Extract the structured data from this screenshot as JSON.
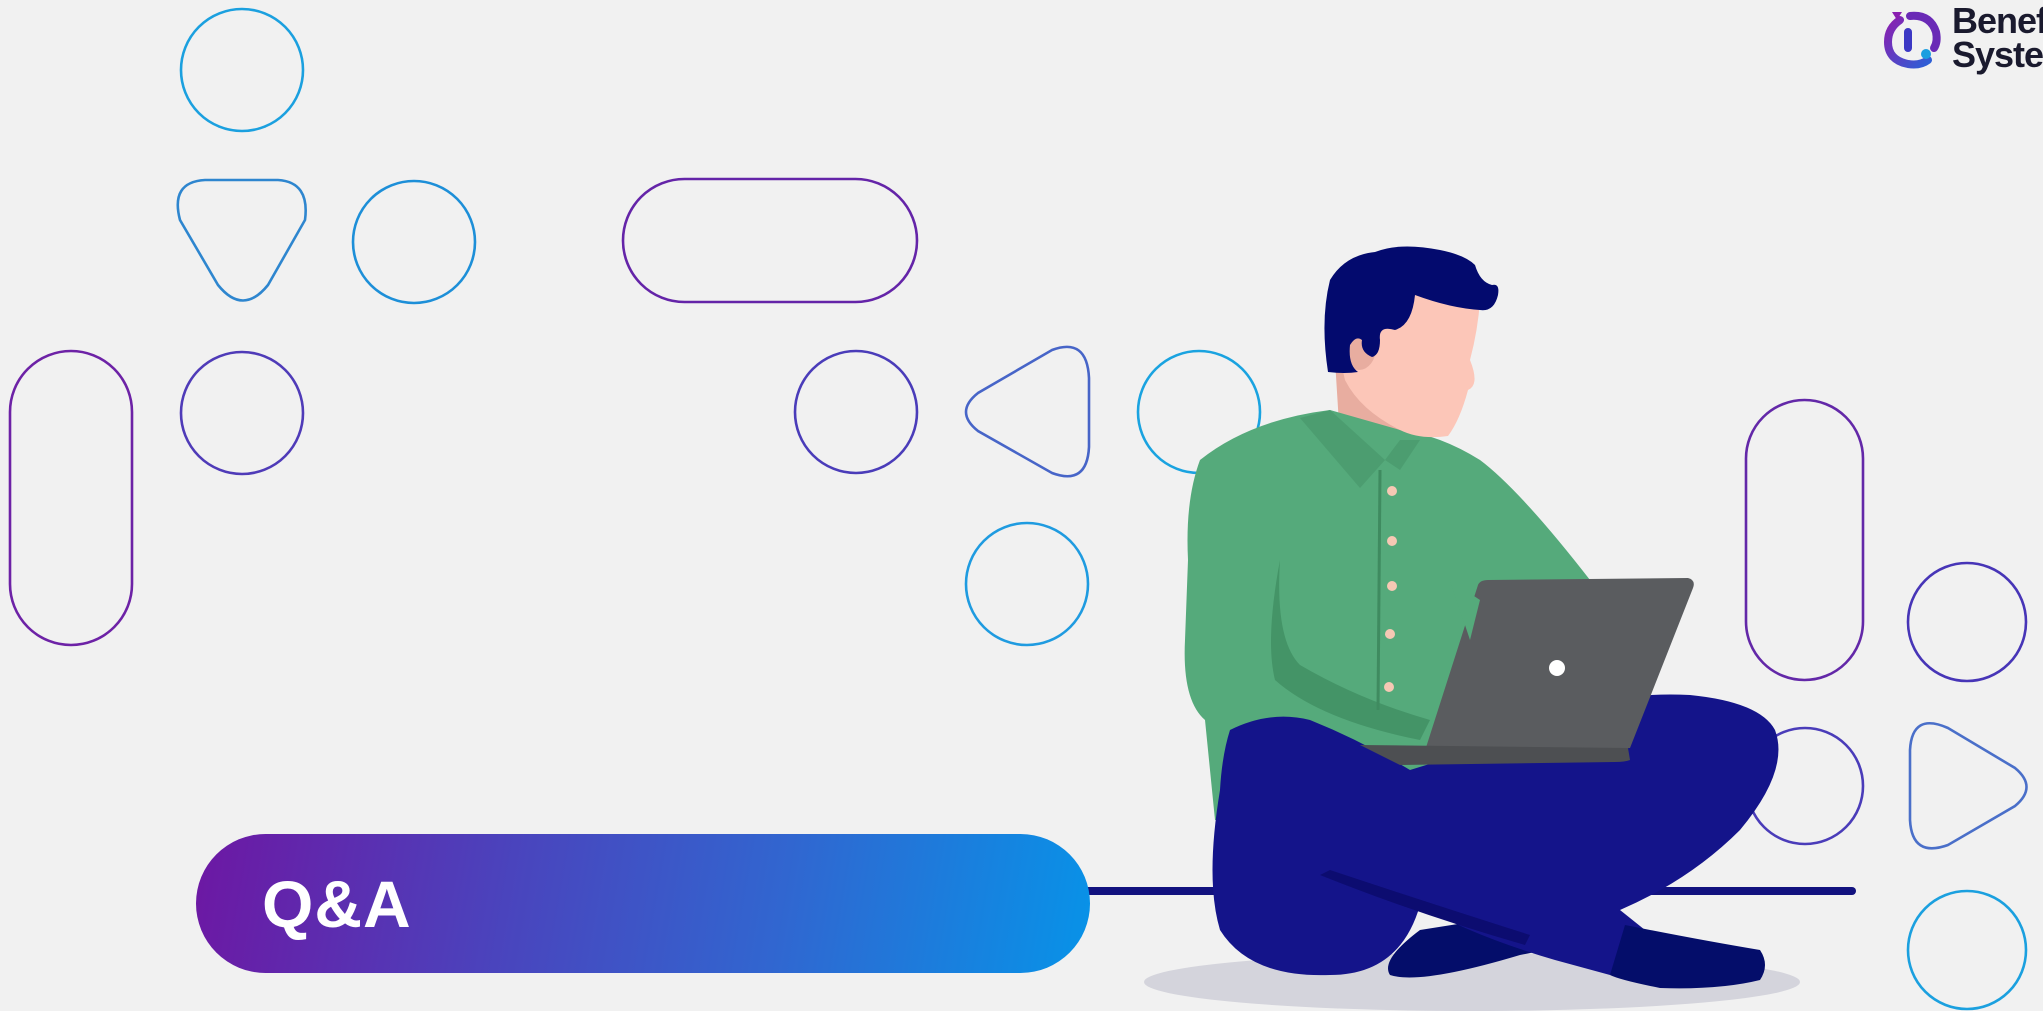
{
  "slide": {
    "title": "Q&A"
  },
  "logo": {
    "text": "Benef\nSyste",
    "icon": "benefit-systems-logo-icon"
  },
  "colors": {
    "background": "#f1f1f1",
    "purple": "#6d17a3",
    "indigo": "#4534b8",
    "blue": "#1a9ee0",
    "banner_start": "#6d17a3",
    "banner_end": "#0793e8",
    "shirt": "#55aa7b",
    "pants": "#14148a",
    "hair": "#030a6e",
    "skin": "#fcc6b8",
    "laptop": "#5a5c5f"
  },
  "icons": [
    "circle-outline-icon",
    "triangle-outline-icon",
    "pill-outline-icon"
  ]
}
